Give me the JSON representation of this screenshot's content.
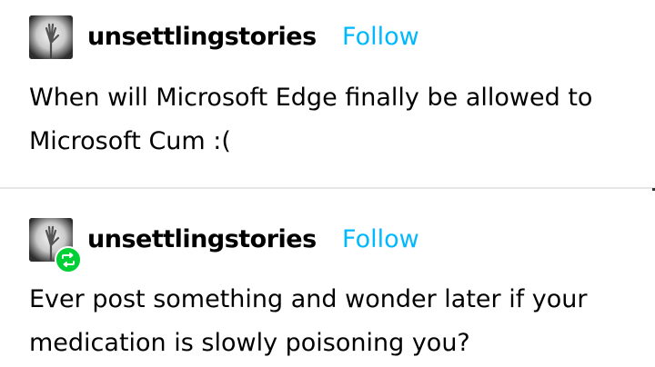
{
  "posts": [
    {
      "username": "unsettlingstories",
      "follow_label": "Follow",
      "text": "When will Microsoft Edge finally be allowed to Microsoft Cum :(",
      "avatar_icon": "ghost-hand-avatar-icon",
      "reblogged": false
    },
    {
      "username": "unsettlingstories",
      "follow_label": "Follow",
      "text": "Ever post something and wonder later if your medication is slowly poisoning you?",
      "avatar_icon": "ghost-hand-avatar-icon",
      "reblogged": true,
      "badge_icon": "reblog-icon"
    }
  ],
  "colors": {
    "follow": "#00b8ff",
    "reblog_badge": "#00cf35",
    "divider": "#e6e6e6"
  }
}
